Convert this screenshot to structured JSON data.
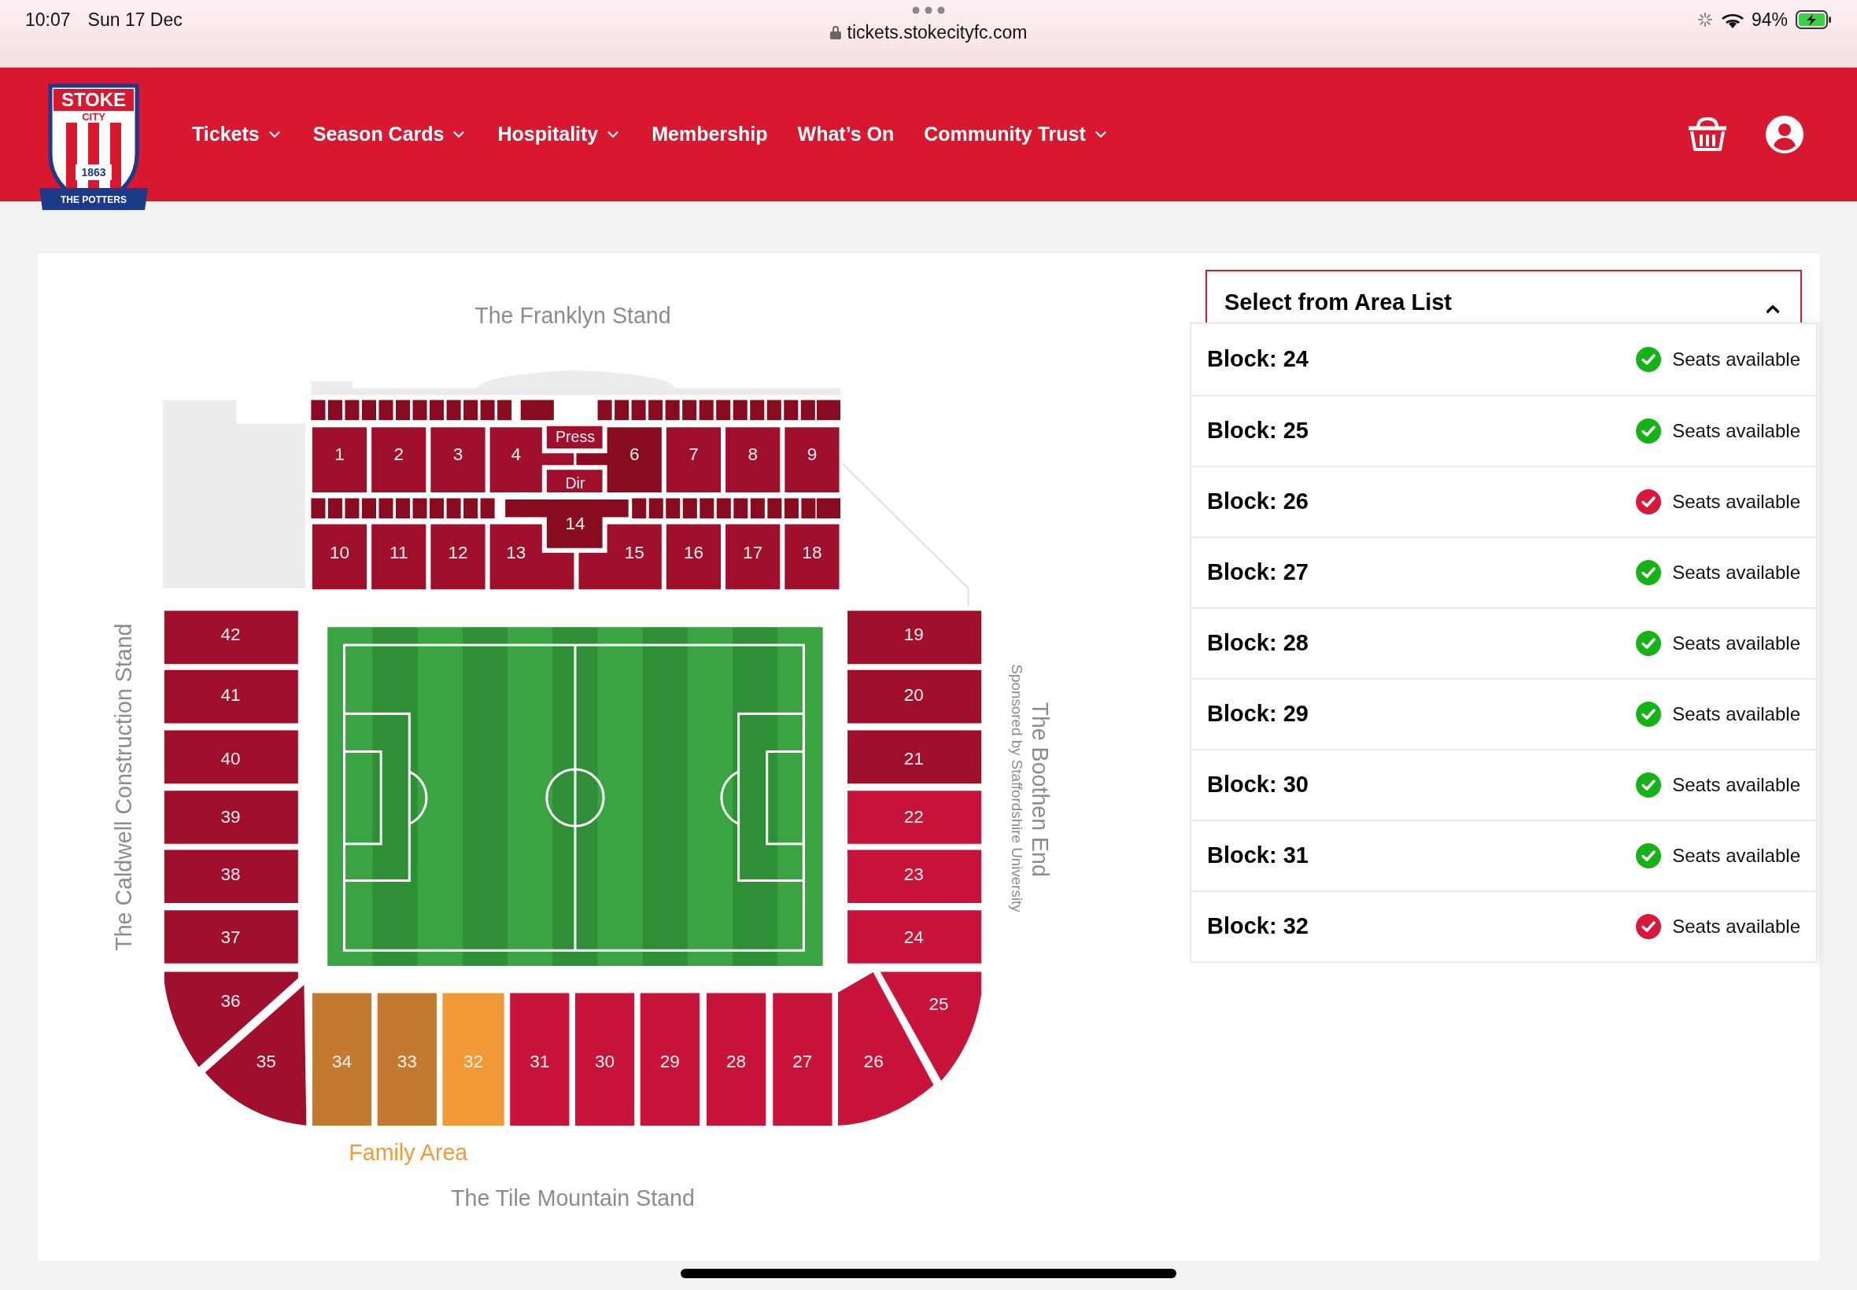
{
  "status_bar": {
    "time": "10:07",
    "date": "Sun 17 Dec",
    "url": "tickets.stokecityfc.com",
    "battery": "94%"
  },
  "logo": {
    "top": "STOKE",
    "middle": "CITY",
    "year": "1863",
    "motto": "THE POTTERS"
  },
  "nav": [
    {
      "label": "Tickets",
      "dropdown": true
    },
    {
      "label": "Season Cards",
      "dropdown": true
    },
    {
      "label": "Hospitality",
      "dropdown": true
    },
    {
      "label": "Membership",
      "dropdown": false
    },
    {
      "label": "What’s On",
      "dropdown": false
    },
    {
      "label": "Community Trust",
      "dropdown": true
    }
  ],
  "stadium": {
    "north": "The Franklyn Stand",
    "west": "The Caldwell Construction Stand",
    "east": "The Boothen End",
    "east_sponsor": "Sponsored by Staffordshire University",
    "south": "The Tile Mountain Stand",
    "family": "Family Area",
    "blocks": [
      {
        "label": "1",
        "color": "#a00f2b"
      },
      {
        "label": "2",
        "color": "#a00f2b"
      },
      {
        "label": "3",
        "color": "#a00f2b"
      },
      {
        "label": "4",
        "color": "#a00f2b"
      },
      {
        "label": "Press",
        "color": "#a00f2b"
      },
      {
        "label": "Dir",
        "color": "#a00f2b"
      },
      {
        "label": "6",
        "color": "#890b20"
      },
      {
        "label": "7",
        "color": "#a00f2b"
      },
      {
        "label": "8",
        "color": "#a00f2b"
      },
      {
        "label": "9",
        "color": "#a00f2b"
      },
      {
        "label": "10",
        "color": "#a00f2b"
      },
      {
        "label": "11",
        "color": "#a00f2b"
      },
      {
        "label": "12",
        "color": "#a00f2b"
      },
      {
        "label": "13",
        "color": "#a00f2b"
      },
      {
        "label": "14",
        "color": "#890b20"
      },
      {
        "label": "15",
        "color": "#a00f2b"
      },
      {
        "label": "16",
        "color": "#a00f2b"
      },
      {
        "label": "17",
        "color": "#a00f2b"
      },
      {
        "label": "18",
        "color": "#a00f2b"
      },
      {
        "label": "42",
        "color": "#a00f2b"
      },
      {
        "label": "19",
        "color": "#a00f2b"
      },
      {
        "label": "41",
        "color": "#a00f2b"
      },
      {
        "label": "20",
        "color": "#a00f2b"
      },
      {
        "label": "40",
        "color": "#a00f2b"
      },
      {
        "label": "21",
        "color": "#a00f2b"
      },
      {
        "label": "39",
        "color": "#a00f2b"
      },
      {
        "label": "22",
        "color": "#c8133a"
      },
      {
        "label": "38",
        "color": "#a00f2b"
      },
      {
        "label": "23",
        "color": "#c8133a"
      },
      {
        "label": "37",
        "color": "#a00f2b"
      },
      {
        "label": "24",
        "color": "#c8133a"
      },
      {
        "label": "36",
        "color": "#a00f2b"
      },
      {
        "label": "25",
        "color": "#c8133a"
      },
      {
        "label": "35",
        "color": "#a00f2b"
      },
      {
        "label": "34",
        "color": "#c37a30"
      },
      {
        "label": "33",
        "color": "#c37a30"
      },
      {
        "label": "32",
        "color": "#f39a38"
      },
      {
        "label": "31",
        "color": "#c8133a"
      },
      {
        "label": "30",
        "color": "#c8133a"
      },
      {
        "label": "29",
        "color": "#c8133a"
      },
      {
        "label": "28",
        "color": "#c8133a"
      },
      {
        "label": "27",
        "color": "#c8133a"
      },
      {
        "label": "26",
        "color": "#c8133a"
      }
    ]
  },
  "area_list": {
    "title": "Select from Area List",
    "expanded": true,
    "items": [
      {
        "block": "Block: 24",
        "status": "Seats available",
        "color": "#16b316"
      },
      {
        "block": "Block: 25",
        "status": "Seats available",
        "color": "#16b316"
      },
      {
        "block": "Block: 26",
        "status": "Seats available",
        "color": "#d7183a"
      },
      {
        "block": "Block: 27",
        "status": "Seats available",
        "color": "#16b316"
      },
      {
        "block": "Block: 28",
        "status": "Seats available",
        "color": "#16b316"
      },
      {
        "block": "Block: 29",
        "status": "Seats available",
        "color": "#16b316"
      },
      {
        "block": "Block: 30",
        "status": "Seats available",
        "color": "#16b316"
      },
      {
        "block": "Block: 31",
        "status": "Seats available",
        "color": "#16b316"
      },
      {
        "block": "Block: 32",
        "status": "Seats available",
        "color": "#d7183a"
      }
    ]
  }
}
